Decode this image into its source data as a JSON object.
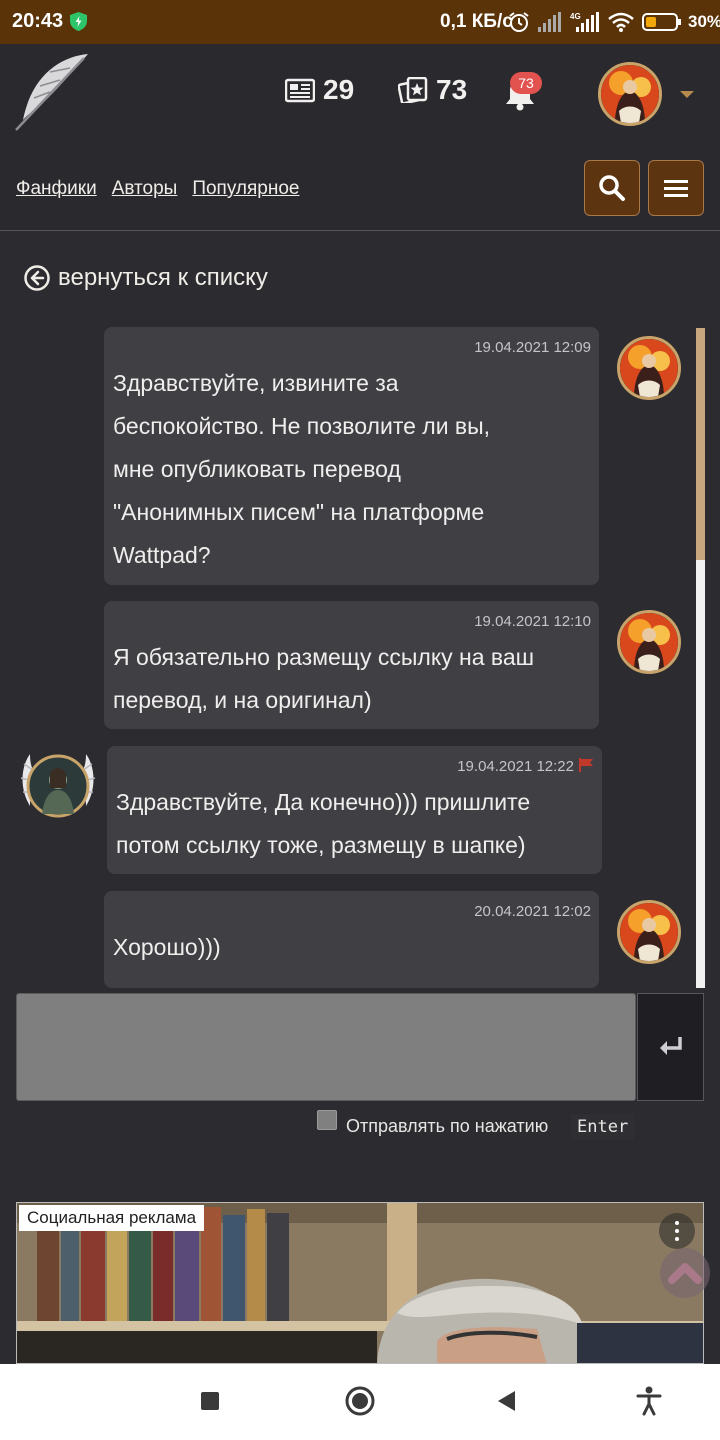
{
  "status_bar": {
    "time": "20:43",
    "net_speed": "0,1 КБ/с",
    "network": "4G",
    "battery": "30%"
  },
  "header": {
    "logo": "feather-logo",
    "stats": [
      {
        "icon": "news-icon",
        "value": "29"
      },
      {
        "icon": "cards-icon",
        "value": "73"
      }
    ],
    "notifications": "73",
    "nav": [
      "Фанфики",
      "Авторы",
      "Популярное"
    ]
  },
  "back_link": "вернуться к списку",
  "messages": [
    {
      "side": "right",
      "time": "19.04.2021 12:09",
      "lines": [
        "Здравствуйте, извините за",
        "беспокойство. Не позволите ли вы,",
        "мне опубликовать перевод",
        "\"Анонимных писем\" на платформе",
        "Wattpad?"
      ]
    },
    {
      "side": "right",
      "time": "19.04.2021 12:10",
      "lines": [
        "Я обязательно размещу ссылку на ваш",
        "перевод, и на оригинал)"
      ]
    },
    {
      "side": "left",
      "time": "19.04.2021 12:22",
      "lines": [
        "Здравствуйте, Да конечно))) пришлите",
        "потом ссылку тоже, размещу в шапке)"
      ]
    },
    {
      "side": "right",
      "time": "20.04.2021 12:02",
      "lines": [
        "Хорошо)))"
      ]
    }
  ],
  "composer": {
    "enter_label": "Отправлять по нажатию",
    "enter_key": "Enter"
  },
  "ad": {
    "label": "Социальная реклама"
  },
  "colors": {
    "accent": "#5c3510",
    "brand_border": "#c9a46a",
    "badge": "#e2524f",
    "status_bar": "#5a3309"
  }
}
